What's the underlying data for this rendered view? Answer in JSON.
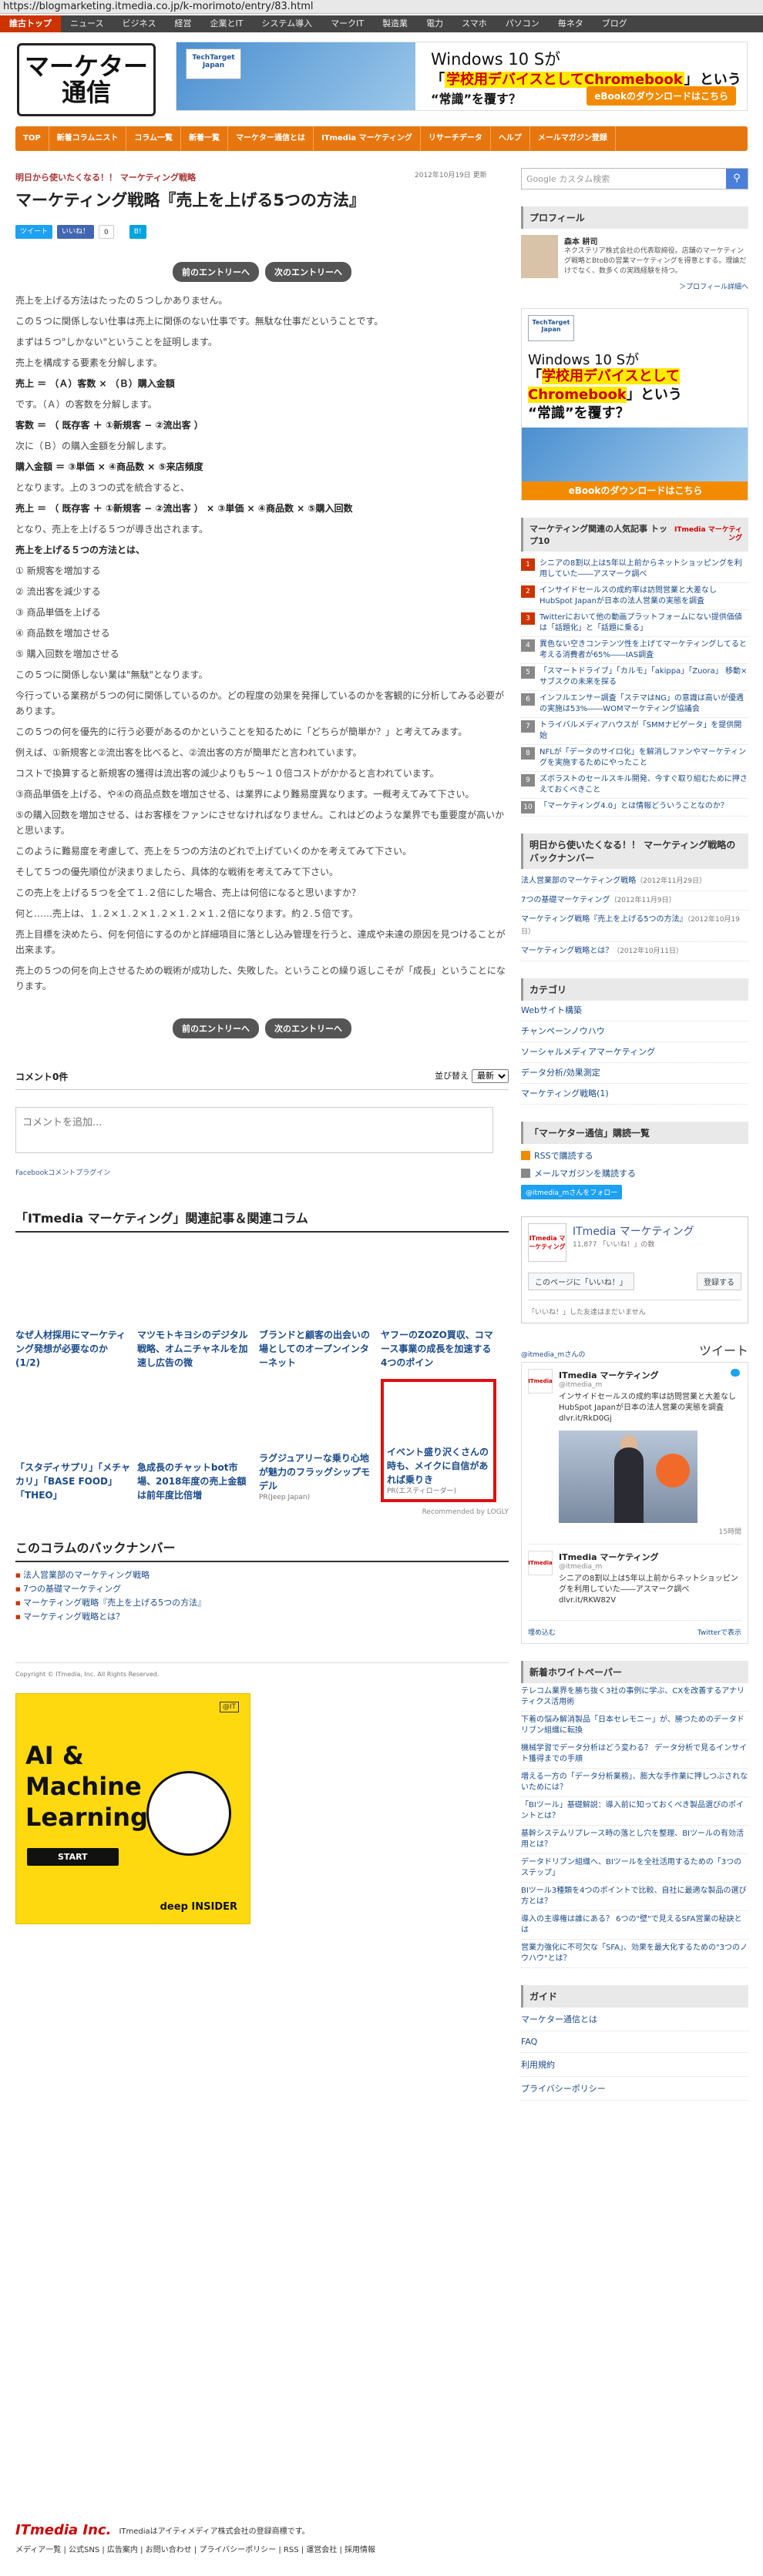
{
  "url": "https://blogmarketing.itmedia.co.jp/k-morimoto/entry/83.html",
  "topnav": [
    "誰古トップ",
    "ニュース",
    "ビジネス",
    "経営",
    "企業とIT",
    "システム導入",
    "マークIT",
    "製造業",
    "電力",
    "スマホ",
    "パソコン",
    "毎ネタ",
    "ブログ"
  ],
  "logo": "マーケター\n通信",
  "banner": {
    "logo": "TechTarget Japan",
    "l1": "Windows 10 Sが",
    "l2": "学校用デバイスとしてChromebook",
    "l2b": "という",
    "l3": "“常識”を覆す？",
    "cta": "eBookのダウンロードはこちら"
  },
  "catnav": [
    "TOP",
    "新着コラムニスト",
    "コラム一覧",
    "新着一覧",
    "マーケター通信とは",
    "ITmedia マーケティング",
    "リサーチデータ",
    "ヘルプ",
    "メールマガジン登録"
  ],
  "date": "2012年10月19日 更新",
  "article": {
    "kicker": "明日から使いたくなる！！ マーケティング戦略",
    "title": "マーケティング戦略『売上を上げる5つの方法』",
    "tweet": "ツイート",
    "like": "いいね！",
    "like_count": "0",
    "bn_count": "B!",
    "prev": "前のエントリーへ",
    "next": "次のエントリーへ",
    "paras": [
      {
        "t": "売上を上げる方法はたったの５つしかありません。",
        "b": false
      },
      {
        "t": "この５つに関係しない仕事は売上に関係のない仕事です。無駄な仕事だということです。",
        "b": false
      },
      {
        "t": "まずは５つ\"しかない\"ということを証明します。",
        "b": false
      },
      {
        "t": "売上を構成する要素を分解します。",
        "b": false
      },
      {
        "t": "売上 ＝ （Ａ）客数 × （Ｂ）購入金額",
        "b": true
      },
      {
        "t": "です。（Ａ）の客数を分解します。",
        "b": false
      },
      {
        "t": "客数 ＝ （ 既存客 ＋ ①新規客 − ②流出客 ）",
        "b": true
      },
      {
        "t": "次に（Ｂ）の購入金額を分解します。",
        "b": false
      },
      {
        "t": "購入金額 ＝ ③単価 × ④商品数 × ⑤来店頻度",
        "b": true
      },
      {
        "t": "となります。上の３つの式を統合すると、",
        "b": false
      },
      {
        "t": "売上 ＝ （ 既存客 ＋ ①新規客 − ②流出客 ） × ③単価 × ④商品数 × ⑤購入回数",
        "b": true
      },
      {
        "t": "となり、売上を上げる５つが導き出されます。",
        "b": false
      },
      {
        "t": "売上を上げる５つの方法とは、",
        "b": true
      },
      {
        "t": "① 新規客を増加する",
        "b": false
      },
      {
        "t": "② 流出客を減少する",
        "b": false
      },
      {
        "t": "③ 商品単価を上げる",
        "b": false
      },
      {
        "t": "④ 商品数を増加させる",
        "b": false
      },
      {
        "t": "⑤ 購入回数を増加させる",
        "b": false
      },
      {
        "t": "この５つに関係しない業は\"無駄\"となります。",
        "b": false
      },
      {
        "t": "今行っている業務が５つの何に関係しているのか。どの程度の効果を発揮しているのかを客観的に分析してみる必要があります。",
        "b": false
      },
      {
        "t": "この５つの何を優先的に行う必要があるのかということを知るために「どちらが簡単か？」と考えてみます。",
        "b": false
      },
      {
        "t": "例えば、①新規客と②流出客を比べると、②流出客の方が簡単だと言われています。",
        "b": false
      },
      {
        "t": "コストで換算すると新規客の獲得は流出客の減少よりも５〜１０倍コストがかかると言われています。",
        "b": false
      },
      {
        "t": "③商品単価を上げる、や④の商品点数を増加させる、は業界により難易度異なります。一概考えてみて下さい。",
        "b": false
      },
      {
        "t": "⑤の購入回数を増加させる、はお客様をファンにさせなければなりません。これはどのような業界でも重要度が高いかと思います。",
        "b": false
      },
      {
        "t": "このように難易度を考慮して、売上を５つの方法のどれで上げていくのかを考えてみて下さい。",
        "b": false
      },
      {
        "t": "そして５つの優先順位が決まりましたら、具体的な戦術を考えてみて下さい。",
        "b": false
      },
      {
        "t": "この売上を上げる５つを全て１.２倍にした場合、売上は何倍になると思いますか？",
        "b": false
      },
      {
        "t": "何と……売上は、１.２×１.２×１.２×１.２×１.２倍になります。約２.５倍です。",
        "b": false
      },
      {
        "t": "売上目標を決めたら、何を何倍にするのかと詳細項目に落とし込み管理を行うと、達成や未達の原因を見つけることが出来ます。",
        "b": false
      },
      {
        "t": "売上の５つの何を向上させるための戦術が成功した、失敗した。ということの繰り返しこそが「成長」ということになります。",
        "b": false
      }
    ]
  },
  "comments": {
    "title": "コメント0件",
    "sort_label": "並び替え",
    "sort_value": "最新",
    "placeholder": "コメントを追加...",
    "plugin": "Facebookコメントプラグイン"
  },
  "related": {
    "title": "「ITmedia マーケティング」関連記事＆関連コラム",
    "row1": [
      "なぜ人材採用にマーケティング発想が必要なのか (1/2)",
      "マツモトキヨシのデジタル戦略、オムニチャネルを加速し広告の微",
      "ブランドと顧客の出会いの場としてのオープンインターネット",
      "ヤフーのZOZO買収、コマース事業の成長を加速する4つのポイン"
    ],
    "row2": [
      "「スタディサプリ」「メチャカリ」「BASE FOOD」「THEO」",
      "急成長のチャットbot市場、2018年度の売上金額は前年度比倍増",
      "ラグジュアリーな乗り心地が魅力のフラッグシップモデル"
    ],
    "row2_pr": "PR(Jeep Japan)",
    "ad_title": "イベント盛り沢くさんの時も、メイクに自信があれば乗りき",
    "ad_pr": "PR(エスティローダー)",
    "recommended": "Recommended by  LOGLY"
  },
  "backnumber": {
    "title": "このコラムのバックナンバー",
    "items": [
      "法人営業部のマーケティング戦略",
      "7つの基礎マーケティング",
      "マーケティング戦略『売上を上げる5つの方法』",
      "マーケティング戦略とは？"
    ]
  },
  "copyright": "Copyright © ITmedia, Inc. All Rights Reserved.",
  "deepad": {
    "logo": "@IT",
    "line1": "AI &",
    "line2": "Machine",
    "line3": "Learning",
    "start": "START",
    "brand": "deep INSIDER"
  },
  "sidebar": {
    "search": "Google カスタム検索",
    "profile_title": "プロフィール",
    "profile_name": "森本 耕司",
    "profile_text": "ネクステリア株式会社の代表取締役。店舗のマーケティング戦略とBtoBの営業マーケティングを得意とする。理論だけでなく、数多くの実践経験を持つ。",
    "profile_more": "＞プロフィール詳細へ",
    "ad": {
      "logo": "TechTarget Japan",
      "l1": "Windows 10 Sが",
      "l2a": "学校用デバイスとして",
      "l2b": "Chromebook",
      "l2c": "という",
      "l3": "“常識”を覆す？",
      "cta": "eBookのダウンロードはこちら"
    },
    "rank_title": "マーケティング関連の人気記事 トップ10",
    "rank_brand": "ITmedia マーケティング",
    "rank": [
      "シニアの8割以上は5年以上前からネットショッピングを利用していた――アスマーク調べ",
      "インサイドセールスの成約率は訪問営業と大差なし HubSpot Japanが日本の法人営業の実態を調査",
      "Twitterにおいて他の動画プラットフォームにない提供価値は「話題化」と「話題に乗る」",
      "異色ない空きコンテンツ性を上げてマーケティングしてると考える消費者が65%――IAS調査",
      "「スマートドライブ」「カルモ」「akippa」「Zuora」 移動×サブスクの未来を探る",
      "インフルエンサー調査「ステマはNG」の意識は高いが優遇の実施は53%――WOMマーケティング協議会",
      "トライバルメディアハウスが「SMMナビゲータ」を提供開始",
      "NFLが「データのサイロ化」を解消しファンやマーケティングを実施するためにやったこと",
      "ズボラストのセールスキル開発、今すぐ取り組むために押さえておくべきこと",
      "「マーケティング4.0」とは情報どういうことなのか？"
    ],
    "bn_title": "明日から使いたくなる！！ マーケティング戦略のバックナンバー",
    "bn": [
      {
        "t": "法人営業部のマーケティング戦略",
        "d": "（2012年11月29日）"
      },
      {
        "t": "7つの基礎マーケティング",
        "d": "（2012年11月9日）"
      },
      {
        "t": "マーケティング戦略『売上を上げる5つの方法』",
        "d": "（2012年10月19日）"
      },
      {
        "t": "マーケティング戦略とは？",
        "d": "（2012年10月11日）"
      }
    ],
    "cat_title": "カテゴリ",
    "cats": [
      "Webサイト構築",
      "チャンペーンノウハウ",
      "ソーシャルメディアマーケティング",
      "データ分析/効果測定",
      "マーケティング戦略(1)"
    ],
    "subs_title": "「マーケター通信」購読一覧",
    "rss": "RSSで購読する",
    "mail": "メールマガジンを購読する",
    "tw": "@itmedia_mさんをフォロー",
    "fb_name": "ITmedia マーケティング",
    "fb_count": "11,877 「いいね！」の数",
    "fb_like": "このページに「いいね！」",
    "fb_reg": "登録する",
    "fb_note": "「いいね！」した友達はまだいません",
    "tw_acct": "@itmedia_mさんの",
    "tw_head": "ツイート",
    "tw_name": "ITmedia マーケティング",
    "tw_id": "@itmedia_m",
    "tw_text1": "インサイドセールスの成約率は訪問営業と大差なし HubSpot Japanが日本の法人営業の実態を調査 dlvr.it/RkD0Gj",
    "tw_count": "15時間",
    "tw_text2": "シニアの8割以上は5年以上前からネットショッピングを利用していた――アスマーク調べ dlvr.it/RKW82V",
    "tw_embed": "埋め込む",
    "tw_view": "Twitterで表示",
    "wp_title": "新着ホワイトペーパー",
    "wp": [
      "テレコム業界を勝ち抜く3社の事例に学ぶ、CXを改善するアナリティクス活用術",
      "下着の悩み解消製品「日本セレモニー」が、勝つためのデータドリブン組織に転換",
      "機械学習でデータ分析はどう変わる？ データ分析で見るインサイト獲得までの手順",
      "増える一方の「データ分析業務」、膨大な手作業に押しつぶされないためには？",
      "「BIツール」基礎解説：導入前に知っておくべき製品選びのポイントとは？",
      "基幹システムリプレース時の落とし穴を整理、BIツールの有効活用とは？",
      "データドリブン組織へ、BIツールを全社活用するための「3つのステップ」",
      "BIツール3種類を4つのポイントで比較、自社に最適な製品の選び方とは？",
      "導入の主導権は誰にある？ 6つの\"壁\"で見えるSFA営業の秘訣とは",
      "営業力強化に不可欠な「SFA」、効果を最大化するための\"3つのノウハウ\"とは？"
    ],
    "guide_title": "ガイド",
    "guide": [
      "マーケター通信とは",
      "FAQ",
      "利用規約",
      "プライバシーポリシー"
    ]
  },
  "footer": {
    "logo": "ITmedia Inc.",
    "copy": "ITmediaはアイティメディア株式会社の登録商標です。",
    "links": "メディア一覧 | 公式SNS | 広告案内 | お問い合わせ | プライバシーポリシー | RSS | 運営会社 | 採用情報"
  }
}
